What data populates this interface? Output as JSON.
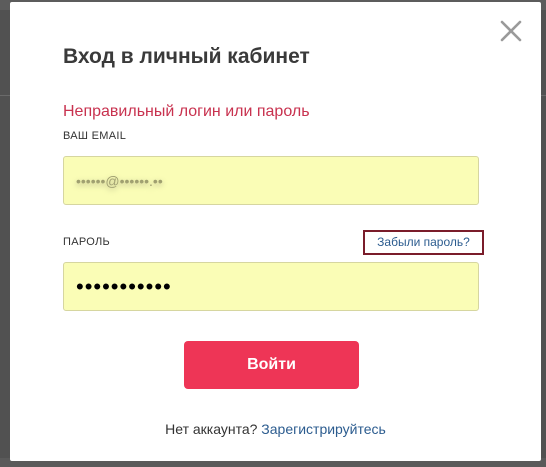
{
  "modal": {
    "title": "Вход в личный кабинет",
    "error_message": "Неправильный логин или пароль",
    "email": {
      "label": "ВАШ EMAIL",
      "value": "••••••@••••••.••"
    },
    "password": {
      "label": "ПАРОЛЬ",
      "value": "•••••••••••"
    },
    "forgot_password": "Забыли пароль?",
    "login_button": "Войти",
    "signup_prompt": "Нет аккаунта?",
    "signup_link": "Зарегистрируйтесь"
  },
  "icons": {
    "close": "close-icon"
  },
  "colors": {
    "accent": "#ee3556",
    "error": "#c8324f",
    "link": "#2c5c8f",
    "autofill": "#fafdb6"
  }
}
